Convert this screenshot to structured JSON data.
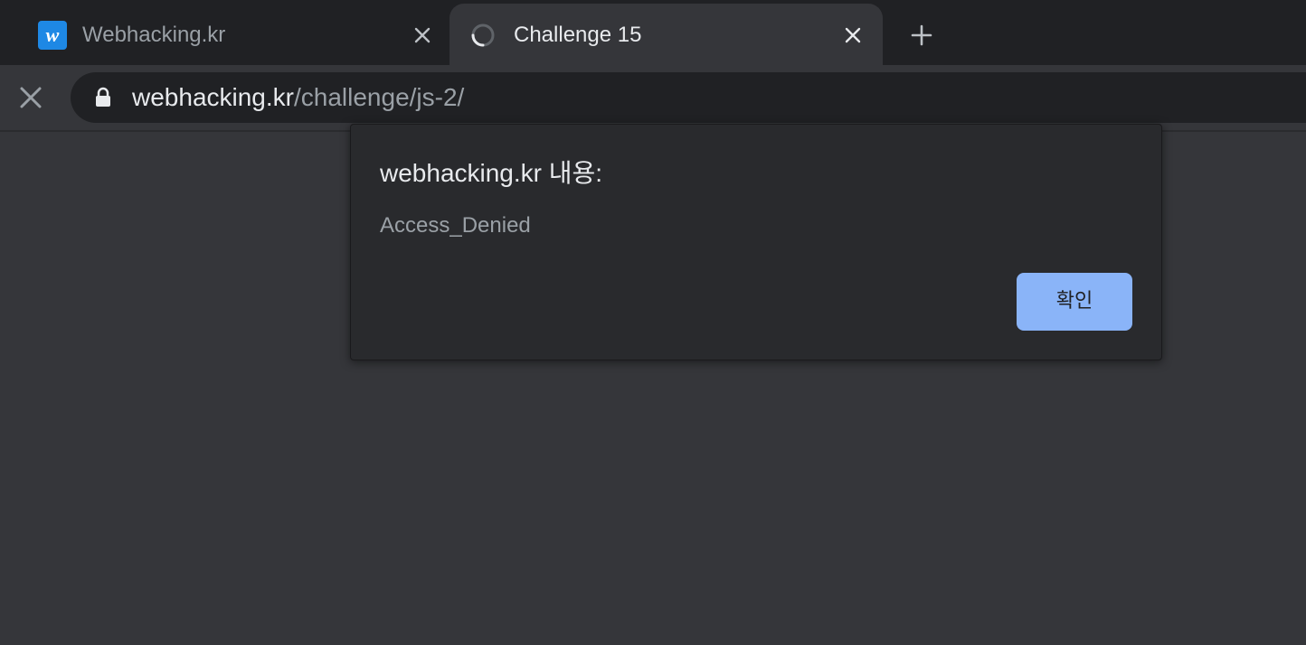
{
  "tabs": [
    {
      "favicon": "w",
      "title": "Webhacking.kr",
      "active": false
    },
    {
      "favicon": "loading-spinner-icon",
      "title": "Challenge 15",
      "active": true
    }
  ],
  "toolbar": {
    "address_host": "webhacking.kr",
    "address_path": "/challenge/js-2/"
  },
  "dialog": {
    "title": "webhacking.kr 내용:",
    "message": "Access_Denied",
    "ok_label": "확인"
  },
  "colors": {
    "tabstrip_bg": "#202124",
    "page_bg": "#35363a",
    "dialog_bg": "#292a2d",
    "accent": "#8ab4f8",
    "favicon_bg": "#1e88e5"
  }
}
